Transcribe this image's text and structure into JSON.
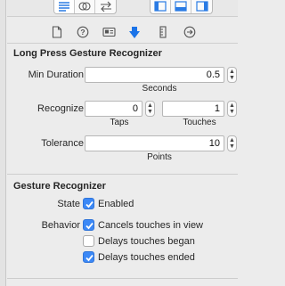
{
  "icons": {
    "toolbar": [
      "left-align-icon",
      "overlap-icon",
      "swap-arrows-icon",
      "panel-left-icon",
      "panel-bottom-icon",
      "panel-right-icon"
    ],
    "tabs": [
      "file-icon",
      "help-icon",
      "identity-icon",
      "attributes-icon",
      "size-icon",
      "connections-icon"
    ]
  },
  "colors": {
    "accent": "#3b88f6",
    "active_tab": "#1a73e8"
  },
  "long_press": {
    "title": "Long Press Gesture Recognizer",
    "min_duration": {
      "label": "Min Duration",
      "value": "0.5",
      "unit": "Seconds"
    },
    "recognize": {
      "label": "Recognize",
      "taps_value": "0",
      "taps_label": "Taps",
      "touches_value": "1",
      "touches_label": "Touches"
    },
    "tolerance": {
      "label": "Tolerance",
      "value": "10",
      "unit": "Points"
    }
  },
  "gesture": {
    "title": "Gesture Recognizer",
    "state_label": "State",
    "enabled_label": "Enabled",
    "enabled_checked": true,
    "behavior_label": "Behavior",
    "cancels_label": "Cancels touches in view",
    "cancels_checked": true,
    "delays_began_label": "Delays touches began",
    "delays_began_checked": false,
    "delays_ended_label": "Delays touches ended",
    "delays_ended_checked": true
  }
}
